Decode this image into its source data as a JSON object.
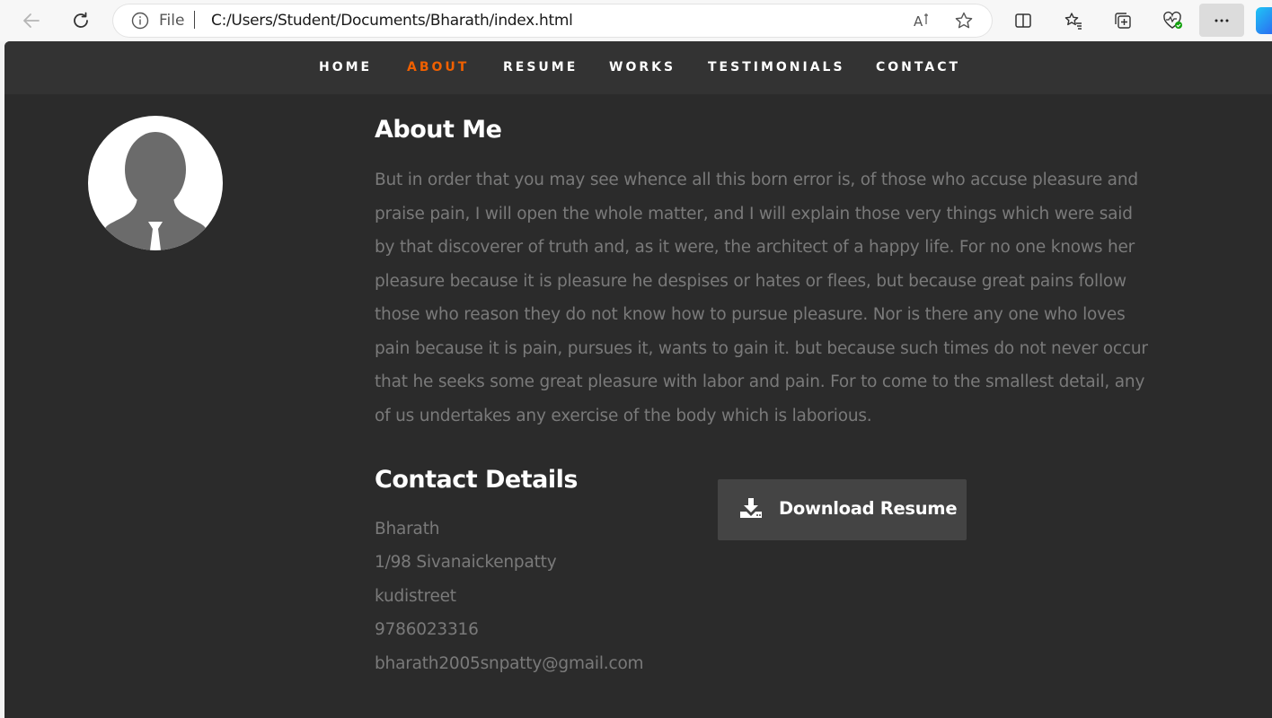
{
  "browser": {
    "file_label": "File",
    "url": "C:/Users/Student/Documents/Bharath/index.html"
  },
  "nav": {
    "items": [
      "HOME",
      "ABOUT",
      "RESUME",
      "WORKS",
      "TESTIMONIALS",
      "CONTACT"
    ],
    "active": "ABOUT",
    "active_color": "#f06000"
  },
  "about": {
    "heading": "About Me",
    "text": "But in order that you may see whence all this born error is, of those who accuse pleasure and praise pain, I will open the whole matter, and I will explain those very things which were said by that discoverer of truth and, as it were, the architect of a happy life. For no one knows her pleasure because it is pleasure he despises or hates or flees, but because great pains follow those who reason they do not know how to pursue pleasure. Nor is there any one who loves pain because it is pain, pursues it, wants to gain it. but because such times do not never occur that he seeks some great pleasure with labor and pain. For to come to the smallest detail, any of us undertakes any exercise of the body which is laborious."
  },
  "contact": {
    "heading": "Contact Details",
    "name": "Bharath",
    "address1": "1/98 Sivanaickenpatty",
    "address2": "kudistreet",
    "phone": "9786023316",
    "email": "bharath2005snpatty@gmail.com"
  },
  "download": {
    "label": "Download Resume",
    "icon": "download-icon"
  },
  "colors": {
    "page_bg": "#2b2b2b",
    "nav_bg": "#333333",
    "text_muted": "#7a7a7a",
    "button_bg": "#444444"
  }
}
